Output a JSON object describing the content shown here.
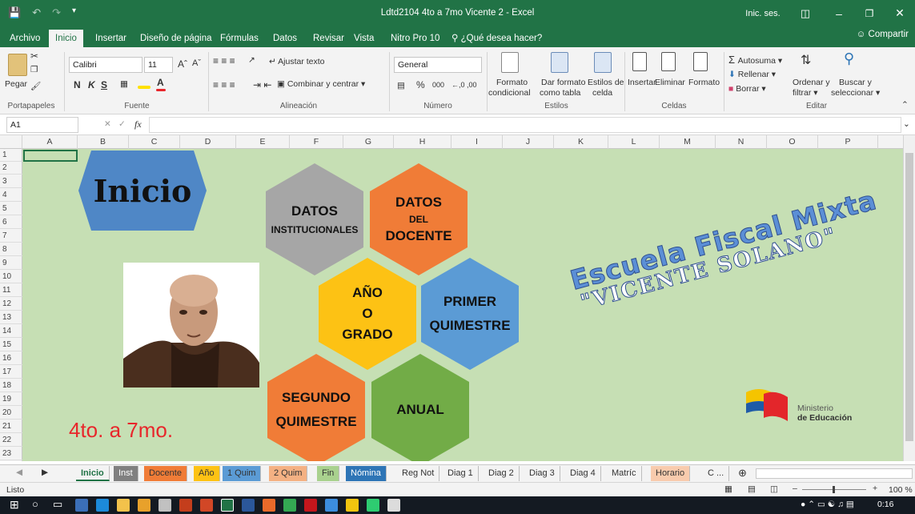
{
  "window": {
    "title": "Ldtd2104 4to a 7mo Vicente 2  -  Excel",
    "signin": "Inic. ses."
  },
  "menu": {
    "tabs": [
      "Archivo",
      "Inicio",
      "Insertar",
      "Diseño de página",
      "Fórmulas",
      "Datos",
      "Revisar",
      "Vista",
      "Nitro Pro 10"
    ],
    "tell_me": "¿Qué desea hacer?",
    "share": "Compartir"
  },
  "ribbon": {
    "clipboard": {
      "paste": "Pegar",
      "label": "Portapapeles"
    },
    "font": {
      "name": "Calibri",
      "size": "11",
      "bold": "N",
      "italic": "K",
      "underline": "S",
      "label": "Fuente"
    },
    "alignment": {
      "wrap": "Ajustar texto",
      "merge": "Combinar y centrar",
      "label": "Alineación"
    },
    "number": {
      "format": "General",
      "percent": "%",
      "thousands": "000",
      "label": "Número"
    },
    "styles": {
      "cond_1": "Formato",
      "cond_2": "condicional",
      "table_1": "Dar formato",
      "table_2": "como tabla",
      "cell_1": "Estilos de",
      "cell_2": "celda",
      "label": "Estilos"
    },
    "cells": {
      "insert": "Insertar",
      "delete": "Eliminar",
      "format": "Formato",
      "label": "Celdas"
    },
    "editing": {
      "autosum": "Autosuma",
      "fill": "Rellenar",
      "clear": "Borrar",
      "sort_1": "Ordenar y",
      "sort_2": "filtrar",
      "find_1": "Buscar y",
      "find_2": "seleccionar",
      "label": "Editar"
    }
  },
  "formula_bar": {
    "name_box": "A1",
    "fx": "fx",
    "value": ""
  },
  "columns": [
    "A",
    "B",
    "C",
    "D",
    "E",
    "F",
    "G",
    "H",
    "I",
    "J",
    "K",
    "L",
    "M",
    "N",
    "O",
    "P"
  ],
  "rows": [
    "1",
    "2",
    "3",
    "4",
    "5",
    "6",
    "7",
    "8",
    "9",
    "10",
    "11",
    "12",
    "13",
    "14",
    "15",
    "16",
    "17",
    "18",
    "19",
    "20",
    "21",
    "22",
    "23"
  ],
  "sheet": {
    "inicio_banner": "Inicio",
    "hex_datos_inst": [
      "DATOS",
      "INSTITUCIONALES"
    ],
    "hex_datos_doc": [
      "DATOS",
      "DEL",
      "DOCENTE"
    ],
    "hex_anio": [
      "AÑO",
      "O",
      "GRADO"
    ],
    "hex_primer": [
      "PRIMER",
      "QUIMESTRE"
    ],
    "hex_segundo": [
      "SEGUNDO",
      "QUIMESTRE"
    ],
    "hex_anual": [
      "ANUAL"
    ],
    "school_line1": "Escuela Fiscal Mixta",
    "school_line2": "\"VICENTE SOLANO\"",
    "grades": "4to. a 7mo.",
    "ministry_1": "Ministerio",
    "ministry_2": "de Educación",
    "colors": {
      "gray": "#a6a6a6",
      "orange": "#f07c37",
      "yellow": "#fdc214",
      "blue": "#5b9bd5",
      "green": "#72ac47",
      "grades_red": "#e8262b",
      "school_blue": "#4472c4",
      "sheet_bg": "#c6dfb4"
    }
  },
  "sheet_tabs": [
    {
      "label": "Inicio",
      "color": "#f3f3f3",
      "active": true
    },
    {
      "label": "Inst",
      "color": "#808080"
    },
    {
      "label": "Docente",
      "color": "#f07c37"
    },
    {
      "label": "Año",
      "color": "#fdc214"
    },
    {
      "label": "1 Quim",
      "color": "#5b9bd5"
    },
    {
      "label": "2 Quim",
      "color": "#f4b183"
    },
    {
      "label": "Fin",
      "color": "#a9d18e"
    },
    {
      "label": "Nómina",
      "color": "#2e75b6"
    },
    {
      "label": "Reg Not",
      "color": "#f3f3f3"
    },
    {
      "label": "Diag 1",
      "color": "#f3f3f3"
    },
    {
      "label": "Diag 2",
      "color": "#f3f3f3"
    },
    {
      "label": "Diag 3",
      "color": "#f3f3f3"
    },
    {
      "label": "Diag 4",
      "color": "#f3f3f3"
    },
    {
      "label": "Matríc",
      "color": "#f3f3f3"
    },
    {
      "label": "Horario",
      "color": "#f8cbad"
    },
    {
      "label": "C ...",
      "color": "#f3f3f3"
    }
  ],
  "status": {
    "ready": "Listo",
    "zoom": "100 %"
  },
  "taskbar": {
    "time": "0:16"
  }
}
